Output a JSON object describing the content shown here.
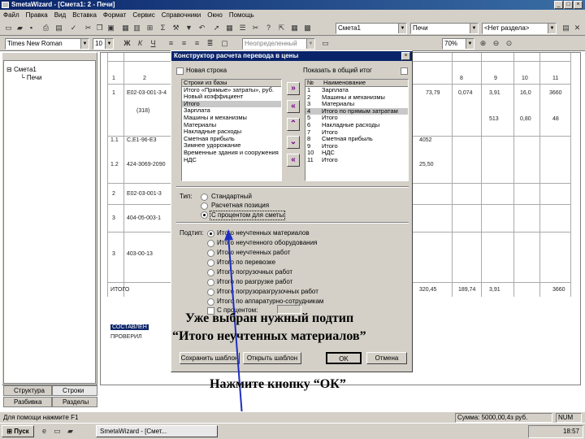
{
  "window": {
    "title": "SmetaWizard - [Смета1: 2 - Печи]"
  },
  "menu": [
    "Файл",
    "Правка",
    "Вид",
    "Вставка",
    "Формат",
    "Сервис",
    "Справочники",
    "Окно",
    "Помощь"
  ],
  "toolbar1": {
    "estimate_select": "Смета1",
    "section_select": "Печи",
    "subsection_select": "<Нет раздела>"
  },
  "toolbar2": {
    "font_select": "Times New Roman",
    "size_select": "10",
    "bold": "Ж",
    "italic": "К",
    "underline": "Ч",
    "style_select": "Неопределенный",
    "zoom_select": "70%"
  },
  "tree": {
    "root": "Смета1",
    "child": "Печи"
  },
  "tabs": [
    "Структура",
    "Строки",
    "Разбивка",
    "Разделы"
  ],
  "sheet": {
    "col_numbers": [
      "1",
      "2",
      "8",
      "9",
      "10",
      "11"
    ],
    "rows": [
      {
        "n": "1",
        "code": "Е02-03-001-3-4",
        "v1": "73,79",
        "v2": "0,074",
        "v3": "3,91",
        "v4": "16,0",
        "v5": "3660"
      },
      {
        "n": "",
        "code": "(318)",
        "v1": "",
        "v2": "",
        "v3": "513",
        "v4": "0,80",
        "v5": "48"
      },
      {
        "n": "1.1",
        "code": "С,Е1-96-Е3",
        "v1": "4052",
        "v2": "",
        "v3": "",
        "v4": "",
        "v5": ""
      },
      {
        "n": "1.2",
        "code": "424-3069-2090",
        "v1": "25,50",
        "v2": "",
        "v3": "",
        "v4": "",
        "v5": ""
      },
      {
        "n": "2",
        "code": "Е02-03-001-3",
        "v1": "",
        "v2": "",
        "v3": "",
        "v4": "",
        "v5": ""
      },
      {
        "n": "3",
        "code": "404-05-003-1",
        "v1": "",
        "v2": "",
        "v3": "",
        "v4": "",
        "v5": ""
      },
      {
        "n": "3",
        "code": "403-00-13",
        "v1": "",
        "v2": "",
        "v3": "",
        "v4": "",
        "v5": ""
      }
    ],
    "total_label": "ИТОГО",
    "total_values": [
      "320,45",
      "189,74",
      "3,91",
      "3660"
    ],
    "highlighted": "СОСТАВЛЕН",
    "checked": "ПРОВЕРИЛ"
  },
  "dialog": {
    "title": "Конструктор расчета перевода в цены",
    "show_in_total": "Показать в общий итог",
    "new_line": "Новая строка",
    "left_list_header": "Строки из базы",
    "left_list": [
      "Итого «Прямые» затраты», руб.",
      "Новый коэффициент",
      "Итого",
      "Зарплата",
      "Машины и механизмы",
      "Материалы",
      "Накладные расходы",
      "Сметная прибыль",
      "Зимнее удорожание",
      "Временные здания и сооружения",
      "НДС"
    ],
    "left_selected_index": 2,
    "right_header_num": "№",
    "right_header_name": "Наименование",
    "right_list": [
      {
        "n": "1",
        "name": "Зарплата"
      },
      {
        "n": "2",
        "name": "Машины и механизмы"
      },
      {
        "n": "3",
        "name": "Материалы"
      },
      {
        "n": "4",
        "name": "Итого по прямым затратам"
      },
      {
        "n": "5",
        "name": "Итого"
      },
      {
        "n": "6",
        "name": "Накладные расходы"
      },
      {
        "n": "7",
        "name": "Итого"
      },
      {
        "n": "8",
        "name": "Сметная прибыль"
      },
      {
        "n": "9",
        "name": "Итого"
      },
      {
        "n": "10",
        "name": "НДС"
      },
      {
        "n": "11",
        "name": "Итого"
      }
    ],
    "right_selected_index": 3,
    "arrows": [
      "»",
      "«",
      "⌃",
      "⌄",
      "«"
    ],
    "type_label": "Тип:",
    "type_options": [
      "Стандартный",
      "Расчетная позиция",
      "С процентом для сметы"
    ],
    "type_selected": 2,
    "subtype_label": "Подтип:",
    "subtype_options": [
      "Итого неучтенных материалов",
      "Итого неучтенного оборудования",
      "Итого неучтенных работ",
      "Итого по перевозке",
      "Итого погрузочных работ",
      "Итого по разгрузке работ",
      "Итого погрузоразгрузочных работ",
      "Итого по аппаратурно-сотрудникам"
    ],
    "subtype_selected": 0,
    "percent_label": "С процентом:",
    "buttons": {
      "save": "Сохранить шаблон",
      "open": "Открыть шаблон",
      "ok": "OK",
      "cancel": "Отмена"
    }
  },
  "annotation": {
    "line1": "Уже выбран нужный подтип",
    "line2": "“Итого неучтенных материалов”",
    "instruction": "Нажмите кнопку “ОК”"
  },
  "status": {
    "left": "Для помощи нажмите F1",
    "sum": "Сумма: 5000,00,4з руб.",
    "mode": "NUM"
  },
  "taskbar": {
    "start": "Пуск",
    "task": "SmetaWizard - [Смет...",
    "time": "18:57"
  },
  "colors": {
    "title_bar": "#0a246a",
    "face": "#d4d0c8",
    "arrow": "#1f2fbf"
  }
}
